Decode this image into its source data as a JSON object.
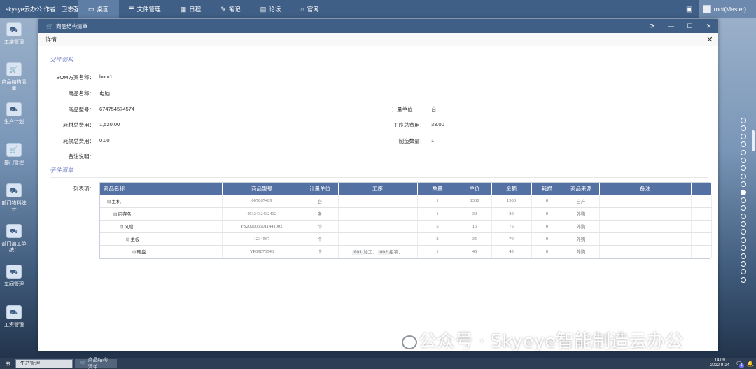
{
  "topbar": {
    "brand": "skyeye云办公 作者：卫志强",
    "nav": [
      {
        "icon": "desktop-icon",
        "glyph": "▭",
        "label": "桌面",
        "active": true
      },
      {
        "icon": "list-icon",
        "glyph": "☰",
        "label": "文件管理",
        "active": false
      },
      {
        "icon": "calendar-icon",
        "glyph": "▦",
        "label": "日程",
        "active": false
      },
      {
        "icon": "edit-icon",
        "glyph": "✎",
        "label": "笔记",
        "active": false
      },
      {
        "icon": "forum-icon",
        "glyph": "▤",
        "label": "论坛",
        "active": false
      },
      {
        "icon": "home-icon",
        "glyph": "⌂",
        "label": "官网",
        "active": false
      }
    ],
    "user": "root(Master)"
  },
  "desktop_icons": [
    {
      "label": "工序管理",
      "glyph": "⛟"
    },
    {
      "label": "商品结构清单",
      "glyph": "🛒"
    },
    {
      "label": "生产计划",
      "glyph": "⛟"
    },
    {
      "label": "部门管理",
      "glyph": "🛒"
    },
    {
      "label": "部门物料统计",
      "glyph": "⛟"
    },
    {
      "label": "部门加工单统计",
      "glyph": "⛟"
    },
    {
      "label": "车间管理",
      "glyph": "⛟"
    },
    {
      "label": "工资管理",
      "glyph": "⛟"
    }
  ],
  "window": {
    "title": "商品结构清单",
    "dialog_title": "详情",
    "parent_section": "父件资料",
    "child_section": "子件清单",
    "fields": {
      "bom_name_label": "BOM方案名称：",
      "bom_name": "bom1",
      "product_name_label": "商品名称：",
      "product_name": "电脑",
      "model_label": "商品型号：",
      "model": "674754574574",
      "unit_label": "计量单位：",
      "unit": "台",
      "material_cost_label": "耗材总费用：",
      "material_cost": "1,520.00",
      "process_cost_label": "工序总费用：",
      "process_cost": "33.00",
      "loss_cost_label": "耗损总费用：",
      "loss_cost": "0.00",
      "quantity_label": "制造数量：",
      "quantity": "1",
      "remark_label": "备注说明：",
      "remark": ""
    },
    "list_label": "列表项："
  },
  "table": {
    "headers": [
      "商品名称",
      "商品型号",
      "计量单位",
      "工序",
      "数量",
      "单价",
      "金额",
      "耗损",
      "商品来源",
      "备注"
    ],
    "rows": [
      {
        "indent": 0,
        "name": "主机",
        "model": "007867489",
        "unit": "台",
        "process": "",
        "qty": "1",
        "price": "1300",
        "amount": "1300",
        "loss": "0",
        "source": "自产",
        "note": ""
      },
      {
        "indent": 1,
        "name": "内存条",
        "model": "4532432432432",
        "unit": "条",
        "process": "",
        "qty": "1",
        "price": "30",
        "amount": "30",
        "loss": "0",
        "source": "外购",
        "note": ""
      },
      {
        "indent": 2,
        "name": "风扇",
        "model": "FS2020065011441002",
        "unit": "个",
        "process": "",
        "qty": "5",
        "price": "15",
        "amount": "75",
        "loss": "0",
        "source": "外购",
        "note": ""
      },
      {
        "indent": 3,
        "name": "主板",
        "model": "1234567",
        "unit": "个",
        "process": "",
        "qty": "2",
        "price": "35",
        "amount": "70",
        "loss": "0",
        "source": "外购",
        "note": ""
      },
      {
        "indent": 4,
        "name": "硬盘",
        "model": "YP09876543",
        "unit": "个",
        "process_codes": [
          "001",
          "002"
        ],
        "process_names": [
          "加工，",
          "组装，"
        ],
        "qty": "1",
        "price": "45",
        "amount": "45",
        "loss": "0",
        "source": "外购",
        "note": ""
      }
    ]
  },
  "watermark": "公众号 · Skyeye智能制造云办公",
  "taskbar": {
    "tasks": [
      "生产管理",
      "商品结构清单"
    ],
    "time": "14:09",
    "date": "2022-9-24",
    "notify_count": "1"
  }
}
